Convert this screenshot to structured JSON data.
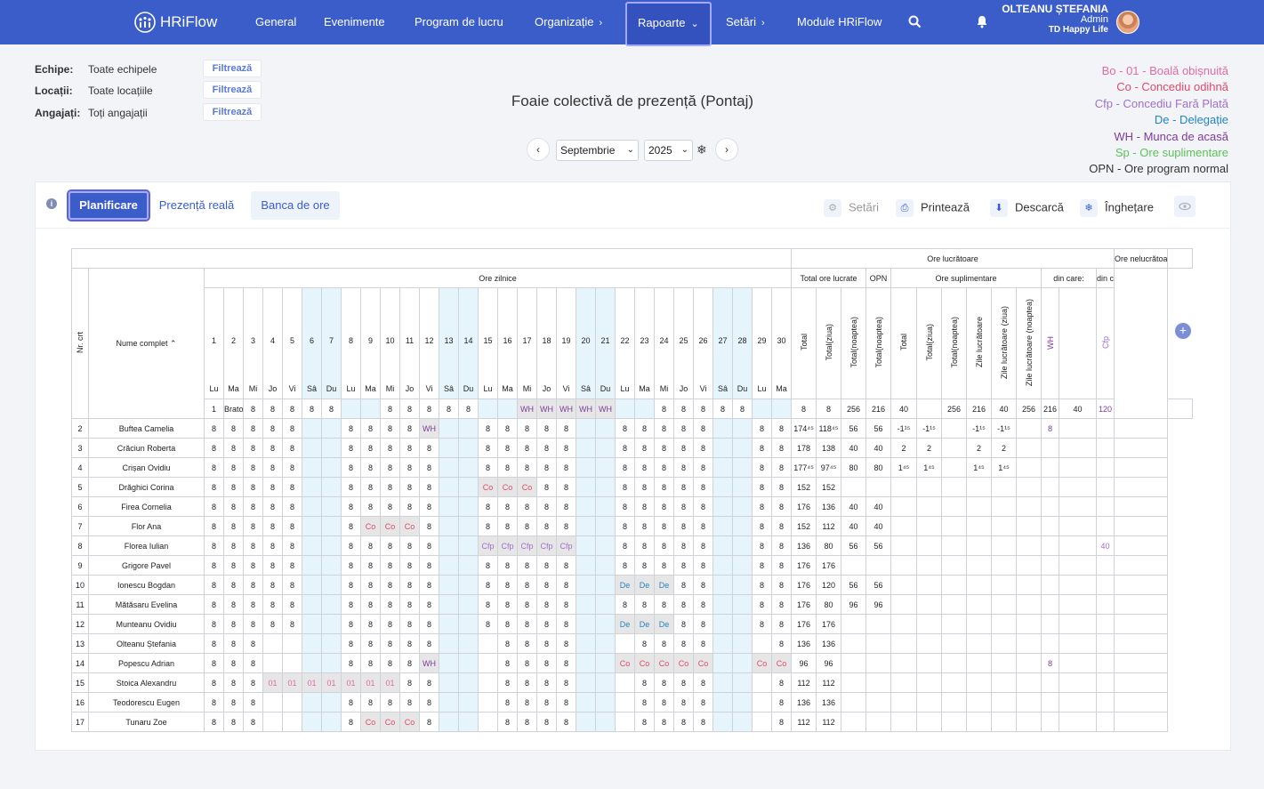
{
  "nav": {
    "logo": "HRiFlow",
    "items": [
      "General",
      "Evenimente",
      "Program de lucru",
      "Organizație",
      "Rapoarte",
      "Setări",
      "Module HRiFlow"
    ],
    "active": "Rapoarte",
    "user_name": "OLTEANU ȘTEFANIA",
    "user_role": "Admin",
    "company": "TD Happy Life"
  },
  "filters": [
    {
      "label": "Echipe:",
      "value": "Toate echipele",
      "button": "Filtrează"
    },
    {
      "label": "Locații:",
      "value": "Toate locațiile",
      "button": "Filtrează"
    },
    {
      "label": "Angajați:",
      "value": "Toți angajații",
      "button": "Filtrează"
    }
  ],
  "title": "Foaie colectivă de prezență (Pontaj)",
  "period": {
    "month": "Septembrie",
    "year": "2025"
  },
  "legend": [
    {
      "text": "Bo - 01 - Boală obișnuită",
      "color": "#e06ba6"
    },
    {
      "text": "Co - Concediu odihnă",
      "color": "#e04a6b"
    },
    {
      "text": "Cfp - Concediu Fară Plată",
      "color": "#a06fd0"
    },
    {
      "text": "De - Delegație",
      "color": "#2584c6"
    },
    {
      "text": "WH - Munca de acasă",
      "color": "#7d3a9f"
    },
    {
      "text": "Sp - Ore suplimentare",
      "color": "#5cc35a"
    },
    {
      "text": "OPN - Ore program normal",
      "color": "#333333"
    }
  ],
  "tabs": {
    "planificare": "Planificare",
    "prezenta": "Prezență reală",
    "banca": "Banca de ore"
  },
  "tools": {
    "setari": "Setări",
    "printeaza": "Printează",
    "descarca": "Descarcă",
    "inghetare": "Înghețare"
  },
  "table": {
    "group_lucratoare": "Ore lucrătoare",
    "group_nelucratoare": "Ore nelucrătoare",
    "ore_zilnice": "Ore zilnice",
    "total_ore_lucrate": "Total ore lucrate",
    "opn": "OPN",
    "ore_suplimentare": "Ore suplimentare",
    "din_care": "din care:",
    "col_nr": "Nr. crt",
    "col_name": "Nume complet",
    "sub_total_cols": [
      "Total",
      "Total(ziua)",
      "Total(noaptea)"
    ],
    "opn_cols": [
      "Total(noaptea)"
    ],
    "sup_cols": [
      "Total",
      "Total(ziua)",
      "Total(noaptea)",
      "Zile lucrătoare",
      "Zile lucrătoare (ziua)",
      "Zile lucrătoare (noaptea)"
    ],
    "din_care_lucr": [
      "WH",
      ""
    ],
    "din_care_nelucr": [
      "Cfp",
      ""
    ],
    "days": [
      "1",
      "2",
      "3",
      "4",
      "5",
      "6",
      "7",
      "8",
      "9",
      "10",
      "11",
      "12",
      "13",
      "14",
      "15",
      "16",
      "17",
      "18",
      "19",
      "20",
      "21",
      "22",
      "23",
      "24",
      "25",
      "26",
      "27",
      "28",
      "29",
      "30"
    ],
    "day_names": [
      "Lu",
      "Ma",
      "Mi",
      "Jo",
      "Vi",
      "Sâ",
      "Du",
      "Lu",
      "Ma",
      "Mi",
      "Jo",
      "Vi",
      "Sâ",
      "Du",
      "Lu",
      "Ma",
      "Mi",
      "Jo",
      "Vi",
      "Sâ",
      "Du",
      "Lu",
      "Ma",
      "Mi",
      "Jo",
      "Vi",
      "Sâ",
      "Du",
      "Lu",
      "Ma"
    ],
    "rows": [
      {
        "nr": "1",
        "name": "Bratosin Lili",
        "days": [
          "8",
          "8",
          "8",
          "8",
          "8",
          "",
          "",
          "8",
          "8",
          "8",
          "8",
          "8",
          "",
          "",
          "WH",
          "WH",
          "WH",
          "WH",
          "WH",
          "",
          "",
          "8",
          "8",
          "8",
          "8",
          "8",
          "",
          "",
          "8",
          "8"
        ],
        "totals": [
          "256",
          "216",
          "40",
          "",
          "256",
          "216",
          "40",
          "256",
          "216",
          "40",
          "120",
          "",
          "",
          ""
        ]
      },
      {
        "nr": "2",
        "name": "Buftea Camelia",
        "days": [
          "8",
          "8",
          "8",
          "8",
          "8",
          "",
          "",
          "8",
          "8",
          "8",
          "8",
          "WH",
          "",
          "",
          "8",
          "8",
          "8",
          "8",
          "8",
          "",
          "",
          "8",
          "8",
          "8",
          "8",
          "8",
          "",
          "",
          "8",
          "8"
        ],
        "totals": [
          "174⁴⁵",
          "118⁴⁵",
          "56",
          "56",
          "-1¹⁵",
          "-1¹⁵",
          "",
          "-1¹⁵",
          "-1¹⁵",
          "",
          "8",
          "",
          "",
          ""
        ]
      },
      {
        "nr": "3",
        "name": "Crăciun Roberta",
        "days": [
          "8",
          "8",
          "8",
          "8",
          "8",
          "",
          "",
          "8",
          "8",
          "8",
          "8",
          "8",
          "",
          "",
          "8",
          "8",
          "8",
          "8",
          "8",
          "",
          "",
          "8",
          "8",
          "8",
          "8",
          "8",
          "",
          "",
          "8",
          "8"
        ],
        "totals": [
          "178",
          "138",
          "40",
          "40",
          "2",
          "2",
          "",
          "2",
          "2",
          "",
          "",
          "",
          "",
          ""
        ]
      },
      {
        "nr": "4",
        "name": "Crișan Ovidiu",
        "days": [
          "8",
          "8",
          "8",
          "8",
          "8",
          "",
          "",
          "8",
          "8",
          "8",
          "8",
          "8",
          "",
          "",
          "8",
          "8",
          "8",
          "8",
          "8",
          "",
          "",
          "8",
          "8",
          "8",
          "8",
          "8",
          "",
          "",
          "8",
          "8"
        ],
        "totals": [
          "177⁴⁵",
          "97⁴⁵",
          "80",
          "80",
          "1⁴⁵",
          "1⁴⁵",
          "",
          "1⁴⁵",
          "1⁴⁵",
          "",
          "",
          "",
          "",
          ""
        ]
      },
      {
        "nr": "5",
        "name": "Drăghici Corina",
        "days": [
          "8",
          "8",
          "8",
          "8",
          "8",
          "",
          "",
          "8",
          "8",
          "8",
          "8",
          "8",
          "",
          "",
          "Co",
          "Co",
          "Co",
          "8",
          "8",
          "",
          "",
          "8",
          "8",
          "8",
          "8",
          "8",
          "",
          "",
          "8",
          "8"
        ],
        "totals": [
          "152",
          "152",
          "",
          "",
          "",
          "",
          "",
          "",
          "",
          "",
          "",
          "",
          "",
          ""
        ]
      },
      {
        "nr": "6",
        "name": "Firea Cornelia",
        "days": [
          "8",
          "8",
          "8",
          "8",
          "8",
          "",
          "",
          "8",
          "8",
          "8",
          "8",
          "8",
          "",
          "",
          "8",
          "8",
          "8",
          "8",
          "8",
          "",
          "",
          "8",
          "8",
          "8",
          "8",
          "8",
          "",
          "",
          "8",
          "8"
        ],
        "totals": [
          "176",
          "136",
          "40",
          "40",
          "",
          "",
          "",
          "",
          "",
          "",
          "",
          "",
          "",
          ""
        ]
      },
      {
        "nr": "7",
        "name": "Flor Ana",
        "days": [
          "8",
          "8",
          "8",
          "8",
          "8",
          "",
          "",
          "8",
          "Co",
          "Co",
          "Co",
          "8",
          "",
          "",
          "8",
          "8",
          "8",
          "8",
          "8",
          "",
          "",
          "8",
          "8",
          "8",
          "8",
          "8",
          "",
          "",
          "8",
          "8"
        ],
        "totals": [
          "152",
          "112",
          "40",
          "40",
          "",
          "",
          "",
          "",
          "",
          "",
          "",
          "",
          "",
          ""
        ]
      },
      {
        "nr": "8",
        "name": "Florea Iulian",
        "days": [
          "8",
          "8",
          "8",
          "8",
          "8",
          "",
          "",
          "8",
          "8",
          "8",
          "8",
          "8",
          "",
          "",
          "Cfp",
          "Cfp",
          "Cfp",
          "Cfp",
          "Cfp",
          "",
          "",
          "8",
          "8",
          "8",
          "8",
          "8",
          "",
          "",
          "8",
          "8"
        ],
        "totals": [
          "136",
          "80",
          "56",
          "56",
          "",
          "",
          "",
          "",
          "",
          "",
          "",
          "",
          "40",
          ""
        ]
      },
      {
        "nr": "9",
        "name": "Grigore Pavel",
        "days": [
          "8",
          "8",
          "8",
          "8",
          "8",
          "",
          "",
          "8",
          "8",
          "8",
          "8",
          "8",
          "",
          "",
          "8",
          "8",
          "8",
          "8",
          "8",
          "",
          "",
          "8",
          "8",
          "8",
          "8",
          "8",
          "",
          "",
          "8",
          "8"
        ],
        "totals": [
          "176",
          "176",
          "",
          "",
          "",
          "",
          "",
          "",
          "",
          "",
          "",
          "",
          "",
          ""
        ]
      },
      {
        "nr": "10",
        "name": "Ionescu Bogdan",
        "days": [
          "8",
          "8",
          "8",
          "8",
          "8",
          "",
          "",
          "8",
          "8",
          "8",
          "8",
          "8",
          "",
          "",
          "8",
          "8",
          "8",
          "8",
          "8",
          "",
          "",
          "De",
          "De",
          "De",
          "8",
          "8",
          "",
          "",
          "8",
          "8"
        ],
        "totals": [
          "176",
          "120",
          "56",
          "56",
          "",
          "",
          "",
          "",
          "",
          "",
          "",
          "",
          "",
          ""
        ]
      },
      {
        "nr": "11",
        "name": "Mătăsaru Evelina",
        "days": [
          "8",
          "8",
          "8",
          "8",
          "8",
          "",
          "",
          "8",
          "8",
          "8",
          "8",
          "8",
          "",
          "",
          "8",
          "8",
          "8",
          "8",
          "8",
          "",
          "",
          "8",
          "8",
          "8",
          "8",
          "8",
          "",
          "",
          "8",
          "8"
        ],
        "totals": [
          "176",
          "80",
          "96",
          "96",
          "",
          "",
          "",
          "",
          "",
          "",
          "",
          "",
          "",
          ""
        ]
      },
      {
        "nr": "12",
        "name": "Munteanu Ovidiu",
        "days": [
          "8",
          "8",
          "8",
          "8",
          "8",
          "",
          "",
          "8",
          "8",
          "8",
          "8",
          "8",
          "",
          "",
          "8",
          "8",
          "8",
          "8",
          "8",
          "",
          "",
          "De",
          "De",
          "De",
          "8",
          "8",
          "",
          "",
          "8",
          "8"
        ],
        "totals": [
          "176",
          "176",
          "",
          "",
          "",
          "",
          "",
          "",
          "",
          "",
          "",
          "",
          "",
          ""
        ]
      },
      {
        "nr": "13",
        "name": "Olteanu Ștefania",
        "days": [
          "8",
          "8",
          "8",
          "",
          "",
          "",
          "",
          "8",
          "8",
          "8",
          "8",
          "8",
          "",
          "",
          "",
          "8",
          "8",
          "8",
          "8",
          "",
          "",
          "",
          "8",
          "8",
          "8",
          "8",
          "",
          "",
          "",
          "8"
        ],
        "totals": [
          "136",
          "136",
          "",
          "",
          "",
          "",
          "",
          "",
          "",
          "",
          "",
          "",
          "",
          ""
        ]
      },
      {
        "nr": "14",
        "name": "Popescu Adrian",
        "days": [
          "8",
          "8",
          "8",
          "",
          "",
          "",
          "",
          "8",
          "8",
          "8",
          "8",
          "WH",
          "",
          "",
          "",
          "8",
          "8",
          "8",
          "8",
          "",
          "",
          "Co",
          "Co",
          "Co",
          "Co",
          "Co",
          "",
          "",
          "Co",
          "Co"
        ],
        "totals": [
          "96",
          "96",
          "",
          "",
          "",
          "",
          "",
          "",
          "",
          "",
          "8",
          "",
          "",
          ""
        ]
      },
      {
        "nr": "15",
        "name": "Stoica Alexandru",
        "days": [
          "8",
          "8",
          "8",
          "01",
          "01",
          "01",
          "01",
          "01",
          "01",
          "01",
          "8",
          "8",
          "",
          "",
          "",
          "8",
          "8",
          "8",
          "8",
          "",
          "",
          "",
          "8",
          "8",
          "8",
          "8",
          "",
          "",
          "",
          "8"
        ],
        "totals": [
          "112",
          "112",
          "",
          "",
          "",
          "",
          "",
          "",
          "",
          "",
          "",
          "",
          "",
          ""
        ]
      },
      {
        "nr": "16",
        "name": "Teodorescu Eugen",
        "days": [
          "8",
          "8",
          "8",
          "",
          "",
          "",
          "",
          "8",
          "8",
          "8",
          "8",
          "8",
          "",
          "",
          "",
          "8",
          "8",
          "8",
          "8",
          "",
          "",
          "",
          "8",
          "8",
          "8",
          "8",
          "",
          "",
          "",
          "8"
        ],
        "totals": [
          "136",
          "136",
          "",
          "",
          "",
          "",
          "",
          "",
          "",
          "",
          "",
          "",
          "",
          ""
        ]
      },
      {
        "nr": "17",
        "name": "Tunaru Zoe",
        "days": [
          "8",
          "8",
          "8",
          "",
          "",
          "",
          "",
          "8",
          "Co",
          "Co",
          "Co",
          "8",
          "",
          "",
          "",
          "8",
          "8",
          "8",
          "8",
          "",
          "",
          "",
          "8",
          "8",
          "8",
          "8",
          "",
          "",
          "",
          "8"
        ],
        "totals": [
          "112",
          "112",
          "",
          "",
          "",
          "",
          "",
          "",
          "",
          "",
          "",
          "",
          "",
          ""
        ]
      }
    ]
  }
}
